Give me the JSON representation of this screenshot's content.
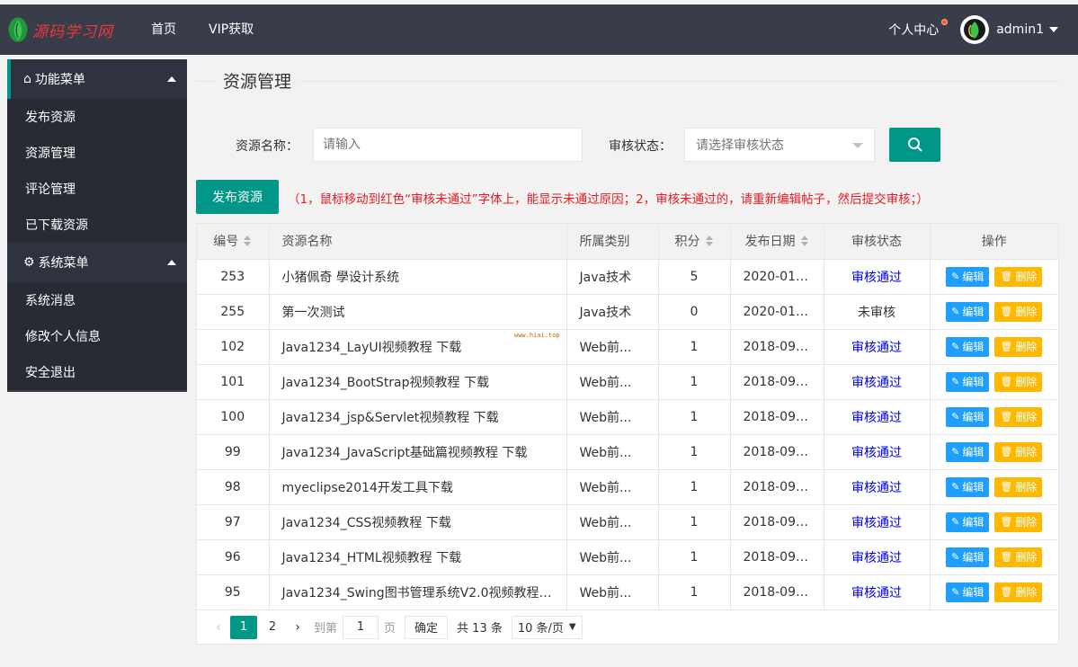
{
  "header": {
    "logo_text": "源码学习网",
    "nav": [
      "首页",
      "VIP获取"
    ],
    "user_center": "个人中心",
    "username": "admin1"
  },
  "sidebar": {
    "groups": [
      {
        "title": "功能菜单",
        "icon": "home-icon",
        "items": [
          "发布资源",
          "资源管理",
          "评论管理",
          "已下载资源"
        ]
      },
      {
        "title": "系统菜单",
        "icon": "gear-icon",
        "items": [
          "系统消息",
          "修改个人信息",
          "安全退出"
        ]
      }
    ]
  },
  "main": {
    "title": "资源管理",
    "search": {
      "name_label": "资源名称：",
      "name_placeholder": "请输入",
      "status_label": "审核状态：",
      "status_placeholder": "请选择审核状态"
    },
    "publish_button": "发布资源",
    "notice": "（1，鼠标移动到红色“审核未通过”字体上，能显示未通过原因；2，审核未通过的，请重新编辑帖子，然后提交审核；）",
    "watermark": "www.hiai.top"
  },
  "table": {
    "columns": [
      "编号",
      "资源名称",
      "所属类别",
      "积分",
      "发布日期",
      "审核状态",
      "操作"
    ],
    "edit_label": "编辑",
    "delete_label": "删除",
    "rows": [
      {
        "id": "253",
        "name": "小猪佩奇 學设计系统",
        "category": "Java技术",
        "points": "5",
        "date": "2020-01-28 ...",
        "status": "审核通过",
        "pass": true
      },
      {
        "id": "255",
        "name": "第一次测试",
        "category": "Java技术",
        "points": "0",
        "date": "2020-01-22 ...",
        "status": "未审核",
        "pass": false
      },
      {
        "id": "102",
        "name": "Java1234_LayUI视频教程 下载",
        "category": "Web前...",
        "points": "1",
        "date": "2018-09-11 ...",
        "status": "审核通过",
        "pass": true
      },
      {
        "id": "101",
        "name": "Java1234_BootStrap视频教程 下载",
        "category": "Web前...",
        "points": "1",
        "date": "2018-09-11 ...",
        "status": "审核通过",
        "pass": true
      },
      {
        "id": "100",
        "name": "Java1234_jsp&Servlet视频教程 下载",
        "category": "Web前...",
        "points": "1",
        "date": "2018-09-11 ...",
        "status": "审核通过",
        "pass": true
      },
      {
        "id": "99",
        "name": "Java1234_JavaScript基础篇视频教程 下载",
        "category": "Web前...",
        "points": "1",
        "date": "2018-09-11 ...",
        "status": "审核通过",
        "pass": true
      },
      {
        "id": "98",
        "name": "myeclipse2014开发工具下载",
        "category": "Web前...",
        "points": "1",
        "date": "2018-09-11 ...",
        "status": "审核通过",
        "pass": true
      },
      {
        "id": "97",
        "name": "Java1234_CSS视频教程 下载",
        "category": "Web前...",
        "points": "1",
        "date": "2018-09-11 ...",
        "status": "审核通过",
        "pass": true
      },
      {
        "id": "96",
        "name": "Java1234_HTML视频教程 下载",
        "category": "Web前...",
        "points": "1",
        "date": "2018-09-11 ...",
        "status": "审核通过",
        "pass": true
      },
      {
        "id": "95",
        "name": "Java1234_Swing图书管理系统V2.0视频教程 ...",
        "category": "Web前...",
        "points": "1",
        "date": "2018-09-11 ...",
        "status": "审核通过",
        "pass": true
      }
    ]
  },
  "pagination": {
    "pages": [
      "1",
      "2"
    ],
    "current_page": "1",
    "goto_label": "到第",
    "goto_value": "1",
    "page_unit": "页",
    "confirm": "确定",
    "total": "共 13 条",
    "per_page": "10 条/页"
  },
  "colors": {
    "topbar": "#393d49",
    "accent": "#009688",
    "edit": "#1e9fff",
    "delete": "#ffb800",
    "notice": "#e51c23",
    "pass": "#0000ee"
  }
}
